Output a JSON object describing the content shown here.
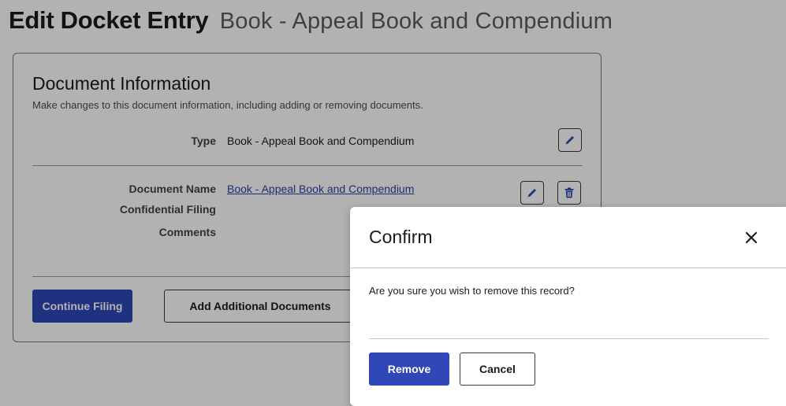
{
  "header": {
    "title": "Edit Docket Entry",
    "subtitle": "Book - Appeal Book and Compendium"
  },
  "card": {
    "title": "Document Information",
    "description": "Make changes to this document information, including adding or removing documents.",
    "type": {
      "label": "Type",
      "value": "Book - Appeal Book and Compendium"
    },
    "document": {
      "name_label": "Document Name",
      "name_value": "Book - Appeal Book and Compendium",
      "confidential_label": "Confidential Filing",
      "comments_label": "Comments"
    },
    "buttons": {
      "continue": "Continue Filing",
      "add_documents": "Add Additional Documents"
    }
  },
  "modal": {
    "title": "Confirm",
    "message": "Are you sure you wish to remove this record?",
    "remove": "Remove",
    "cancel": "Cancel"
  },
  "icons": {
    "edit": "pencil-icon",
    "delete": "trash-icon",
    "close": "close-icon"
  },
  "colors": {
    "primary": "#2f47b7",
    "link": "#2b3fa8",
    "overlay": "rgba(0,0,0,0.30)"
  }
}
